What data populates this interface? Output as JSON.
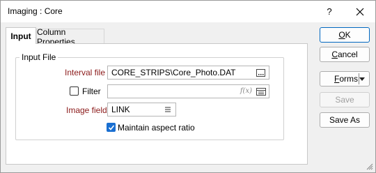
{
  "window": {
    "title": "Imaging : Core"
  },
  "titlebar": {
    "help_label": "?"
  },
  "tabs": [
    {
      "label": "Input"
    },
    {
      "label": "Column Properties"
    }
  ],
  "input_file": {
    "group_label": "Input File",
    "interval_file_label": "Interval file",
    "interval_file_value": "CORE_STRIPS\\Core_Photo.DAT",
    "filter_label": "Filter",
    "filter_checked": false,
    "filter_value": "",
    "filter_fx": "f(x)",
    "image_field_label": "Image field",
    "image_field_value": "LINK",
    "maintain_aspect_label": "Maintain aspect ratio",
    "maintain_aspect_checked": true
  },
  "buttons": {
    "ok": {
      "pre": "",
      "mnemonic": "O",
      "post": "K"
    },
    "cancel": {
      "pre": "",
      "mnemonic": "C",
      "post": "ancel"
    },
    "forms": {
      "pre": "",
      "mnemonic": "F",
      "post": "orms"
    },
    "save": "Save",
    "save_as": "Save As"
  },
  "icons": {
    "close": "close-icon",
    "browse": "ellipsis-icon",
    "fx": "fx-icon",
    "filter_browse": "list-icon",
    "image_field_menu": "menu-lines-icon",
    "forms_dropdown": "chevron-down-icon",
    "resize": "resize-grip-icon"
  },
  "colors": {
    "label_required": "#8b1a1a",
    "accent": "#1a6fd1",
    "primary_border": "#0067c0"
  }
}
